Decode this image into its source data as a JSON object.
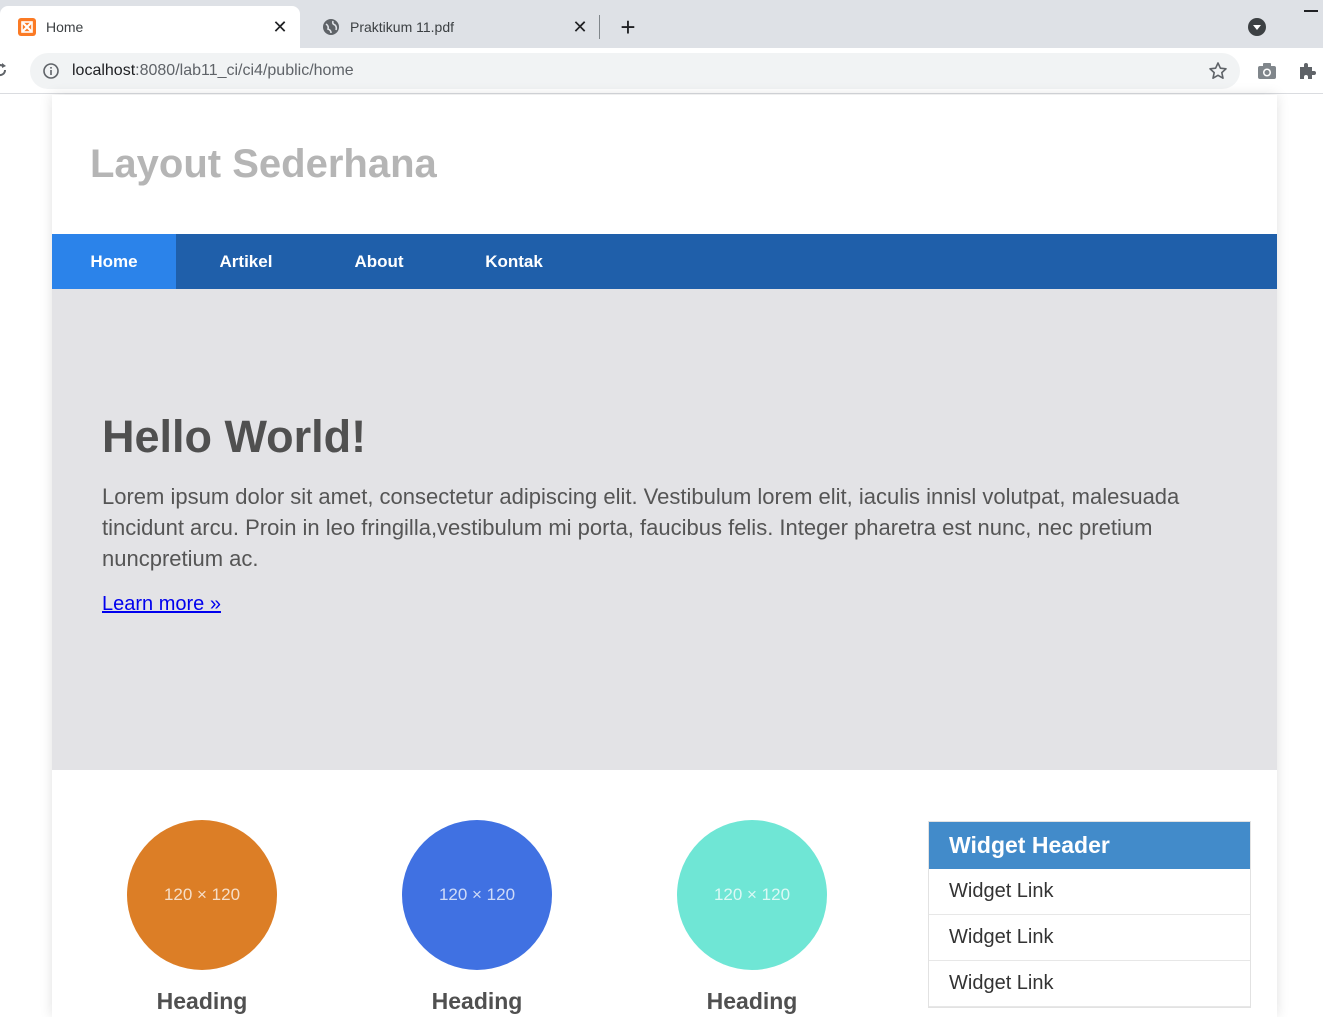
{
  "browser": {
    "tabs": [
      {
        "title": "Home",
        "active": true,
        "favicon": "xampp-icon"
      },
      {
        "title": "Praktikum 11.pdf",
        "active": false,
        "favicon": "globe-icon"
      }
    ],
    "url_host": "localhost",
    "url_rest": ":8080/lab11_ci/ci4/public/home"
  },
  "site": {
    "title": "Layout Sederhana",
    "nav": [
      "Home",
      "Artikel",
      "About",
      "Kontak"
    ]
  },
  "hero": {
    "heading": "Hello World!",
    "text": "Lorem ipsum dolor sit amet, consectetur adipiscing elit. Vestibulum lorem elit, iaculis innisl volutpat, malesuada tincidunt arcu. Proin in leo fringilla,vestibulum mi porta, faucibus felis. Integer pharetra est nunc, nec pretium nuncpretium ac.",
    "link": "Learn more »"
  },
  "features": [
    {
      "placeholder": "120 × 120",
      "heading": "Heading",
      "color": "#dc7e26"
    },
    {
      "placeholder": "120 × 120",
      "heading": "Heading",
      "color": "#4071e2"
    },
    {
      "placeholder": "120 × 120",
      "heading": "Heading",
      "color": "#6fe6d5"
    }
  ],
  "widget": {
    "header": "Widget Header",
    "links": [
      "Widget Link",
      "Widget Link",
      "Widget Link"
    ]
  },
  "colors": {
    "nav_bg": "#1f5faa",
    "nav_active": "#2b83ea",
    "widget_header": "#428bca",
    "hero_bg": "#e3e3e6"
  }
}
